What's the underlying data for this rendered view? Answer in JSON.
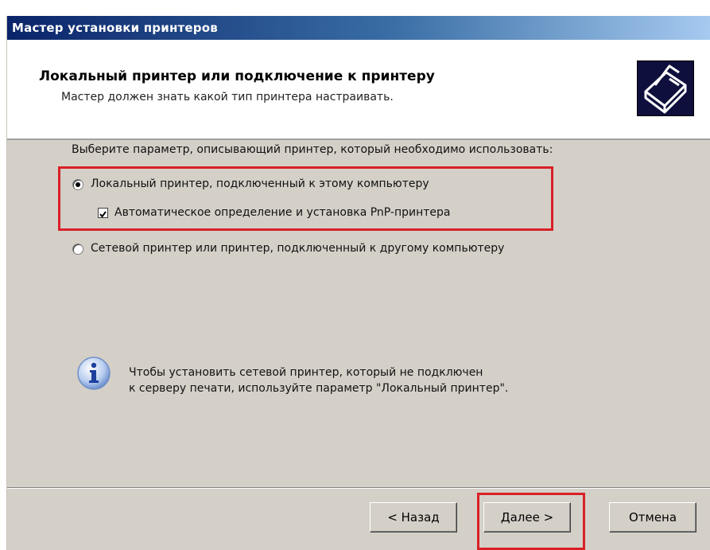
{
  "window": {
    "title": "Мастер установки принтеров"
  },
  "header": {
    "title": "Локальный принтер или подключение к принтеру",
    "subtitle": "Мастер должен знать какой тип принтера настраивать.",
    "icon": "printer-icon"
  },
  "main": {
    "prompt": "Выберите параметр, описывающий принтер, который необходимо использовать:",
    "options": [
      {
        "label": "Локальный принтер, подключенный к этому компьютеру",
        "selected": true
      },
      {
        "label": "Сетевой принтер или принтер, подключенный к другому компьютеру",
        "selected": false
      }
    ],
    "pnp_checkbox": {
      "label": "Автоматическое определение и установка PnP-принтера",
      "checked": true
    },
    "info": {
      "icon": "info-icon",
      "line1": "Чтобы установить сетевой принтер, который не подключен",
      "line2": "к серверу печати, используйте параметр \"Локальный принтер\"."
    }
  },
  "buttons": {
    "back": "< Назад",
    "next": "Далее >",
    "cancel": "Отмена"
  },
  "colors": {
    "highlight": "#d92027",
    "titlebar": "#0a246a",
    "dialog_bg": "#d4d0c8"
  }
}
